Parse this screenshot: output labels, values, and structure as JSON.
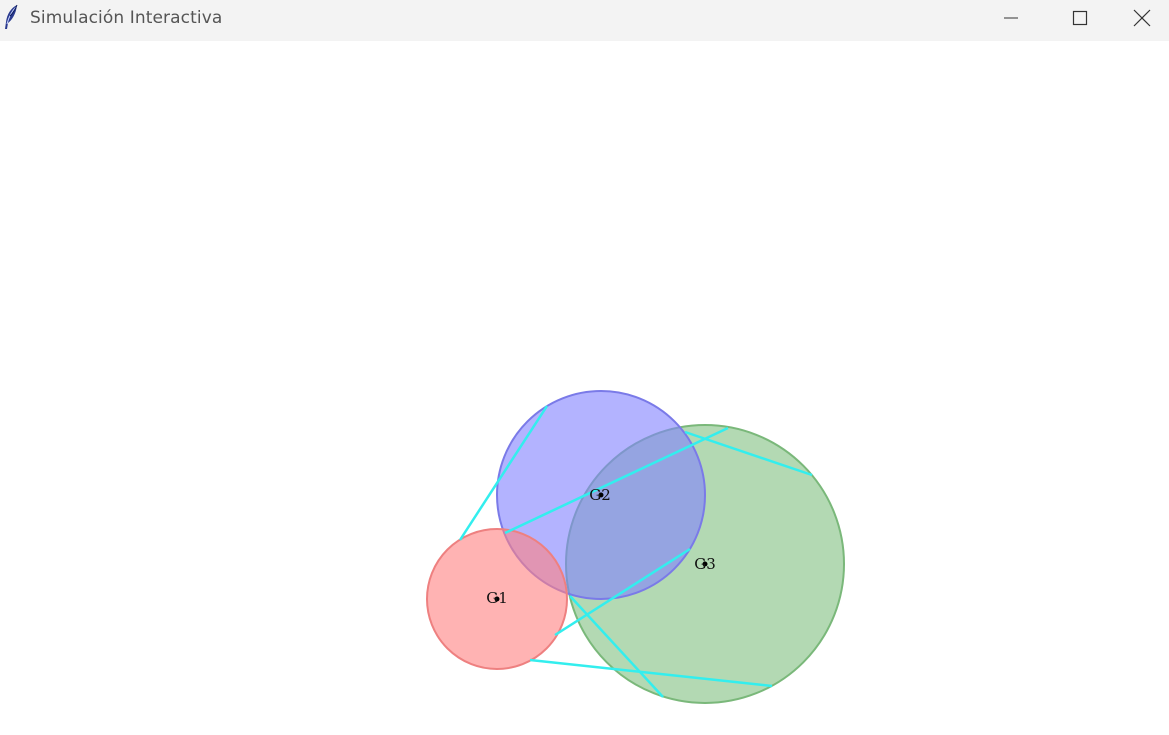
{
  "window": {
    "title": "Simulación Interactiva",
    "app_icon": "feather-icon",
    "controls": {
      "minimize_icon": "minimize-icon",
      "maximize_icon": "maximize-icon",
      "close_icon": "close-icon"
    }
  },
  "canvas": {
    "nodes": [
      {
        "id": "G1",
        "label": "G1",
        "color": "#ff8080"
      },
      {
        "id": "G2",
        "label": "G2",
        "color": "#8080ff"
      },
      {
        "id": "G3",
        "label": "G3",
        "color": "#80c080"
      }
    ],
    "link_color": "#33eeee"
  }
}
